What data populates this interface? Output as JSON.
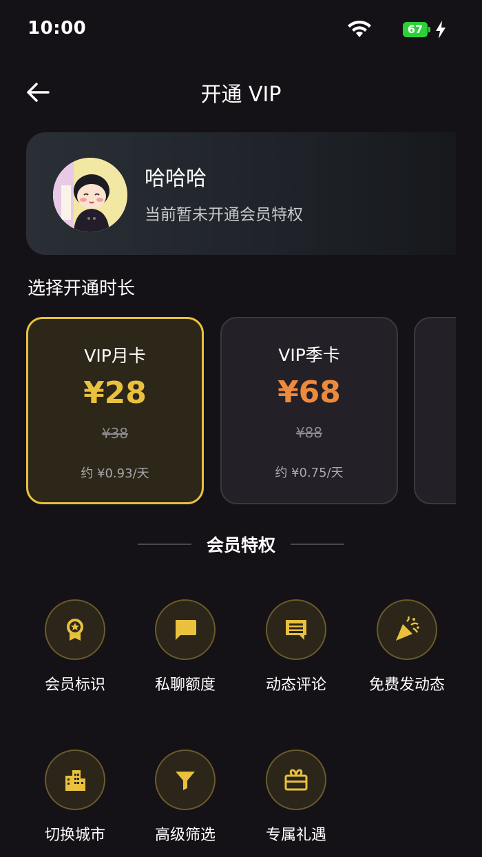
{
  "status_bar": {
    "time": "10:00",
    "battery": "67"
  },
  "header": {
    "title": "开通 VIP"
  },
  "profile": {
    "name": "哈哈哈",
    "status": "当前暂未开通会员特权"
  },
  "duration_section": {
    "label": "选择开通时长"
  },
  "plans": [
    {
      "name": "VIP月卡",
      "price": "¥28",
      "original_price": "¥38",
      "daily": "约 ¥0.93/天",
      "price_color": "#e9c13f",
      "selected": true
    },
    {
      "name": "VIP季卡",
      "price": "¥68",
      "original_price": "¥88",
      "daily": "约 ¥0.75/天",
      "price_color": "#ee8a3c",
      "selected": false
    }
  ],
  "privileges_section": {
    "title": "会员特权"
  },
  "privileges": [
    {
      "label": "会员标识",
      "icon": "badge-icon"
    },
    {
      "label": "私聊额度",
      "icon": "chat-bubble-icon"
    },
    {
      "label": "动态评论",
      "icon": "comment-icon"
    },
    {
      "label": "免费发动态",
      "icon": "party-popper-icon"
    },
    {
      "label": "切换城市",
      "icon": "city-icon"
    },
    {
      "label": "高级筛选",
      "icon": "filter-icon"
    },
    {
      "label": "专属礼遇",
      "icon": "gift-icon"
    }
  ],
  "colors": {
    "accent_gold": "#e9c13f",
    "accent_orange": "#ee8a3c",
    "background": "#141216"
  }
}
